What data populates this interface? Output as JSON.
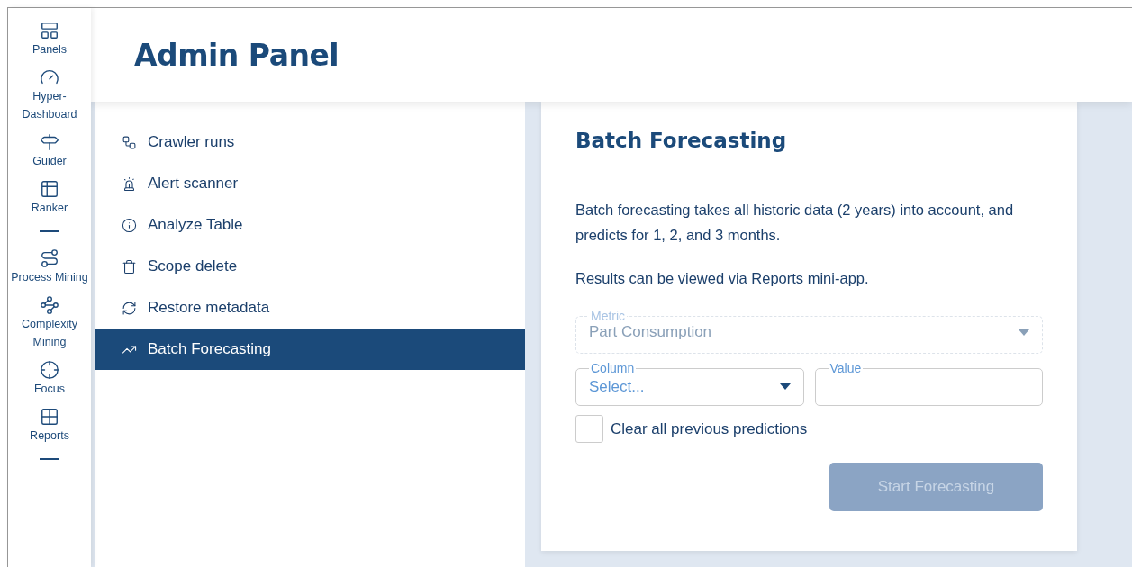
{
  "sidebar": {
    "items": [
      {
        "kind": "nav",
        "label": "Panels"
      },
      {
        "kind": "nav",
        "label": "Hyper-Dashboard"
      },
      {
        "kind": "nav",
        "label": "Guider"
      },
      {
        "kind": "nav",
        "label": "Ranker"
      },
      {
        "kind": "separator"
      },
      {
        "kind": "nav",
        "label": "Process Mining"
      },
      {
        "kind": "nav",
        "label": "Complexity Mining"
      },
      {
        "kind": "nav",
        "label": "Focus"
      },
      {
        "kind": "nav",
        "label": "Reports"
      },
      {
        "kind": "separator"
      }
    ]
  },
  "header": {
    "title": "Admin Panel"
  },
  "menu": {
    "items": [
      {
        "label": "Crawler runs",
        "selected": false
      },
      {
        "label": "Alert scanner",
        "selected": false
      },
      {
        "label": "Analyze Table",
        "selected": false
      },
      {
        "label": "Scope delete",
        "selected": false
      },
      {
        "label": "Restore metadata",
        "selected": false
      },
      {
        "label": "Batch Forecasting",
        "selected": true
      }
    ]
  },
  "card": {
    "title": "Batch Forecasting",
    "paragraphs": [
      "Batch forecasting takes all historic data (2 years) into account, and predicts for 1, 2, and 3 months.",
      "Results can be viewed via Reports mini-app."
    ],
    "metric": {
      "label": "Metric",
      "value": "Part Consumption",
      "disabled": true
    },
    "column": {
      "label": "Column",
      "placeholder": "Select...",
      "disabled": false
    },
    "value_field": {
      "label": "Value"
    },
    "clear_checkbox": {
      "label": "Clear all previous predictions",
      "checked": false
    },
    "start_button": {
      "label": "Start Forecasting",
      "disabled": true
    }
  }
}
